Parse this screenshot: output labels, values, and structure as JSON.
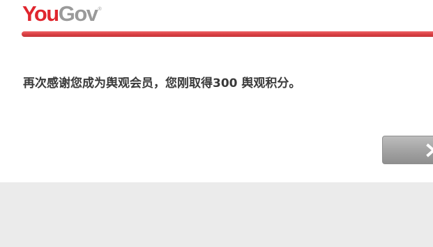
{
  "header": {
    "logo_you": "You",
    "logo_gov": "Gov",
    "logo_mark": "®",
    "brand_color": "#e0262e"
  },
  "main": {
    "message": "再次感谢您成为舆观会员，您刚取得300 舆观积分。"
  },
  "actions": {
    "next_icon": "chevron-right-icon",
    "button_color": "#a4a4a4"
  }
}
